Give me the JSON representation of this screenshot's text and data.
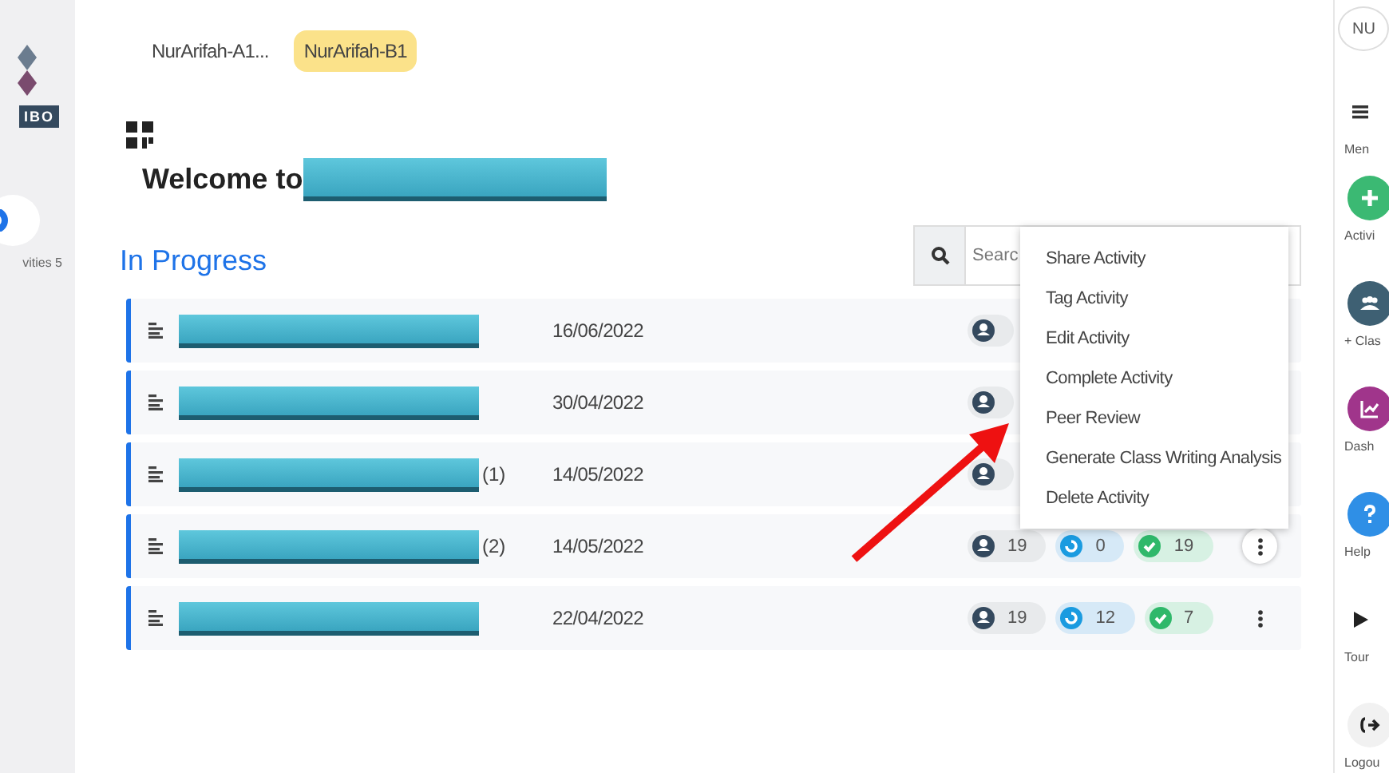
{
  "left_sidebar": {
    "logo_badge": "IBO",
    "label": "vities 5"
  },
  "tabs": [
    {
      "label": "NurArifah-A1...",
      "selected": false
    },
    {
      "label": "NurArifah-B1",
      "selected": true
    }
  ],
  "welcome": {
    "text": "Welcome to"
  },
  "section_title": "In Progress",
  "search": {
    "placeholder": "Searc"
  },
  "rows": [
    {
      "suffix": "",
      "date": "16/06/2022",
      "stats": [
        {
          "kind": "students"
        }
      ]
    },
    {
      "suffix": "",
      "date": "30/04/2022",
      "stats": [
        {
          "kind": "students"
        }
      ]
    },
    {
      "suffix": "(1)",
      "date": "14/05/2022",
      "stats": [
        {
          "kind": "students"
        }
      ]
    },
    {
      "suffix": "(2)",
      "date": "14/05/2022",
      "stats": [
        {
          "kind": "students",
          "count": "19"
        },
        {
          "kind": "progress",
          "count": "0"
        },
        {
          "kind": "done",
          "count": "19"
        }
      ],
      "kebab_active": true
    },
    {
      "suffix": "",
      "date": "22/04/2022",
      "stats": [
        {
          "kind": "students",
          "count": "19"
        },
        {
          "kind": "progress",
          "count": "12"
        },
        {
          "kind": "done",
          "count": "7"
        }
      ],
      "kebab_active": false
    }
  ],
  "context_menu": [
    "Share Activity",
    "Tag Activity",
    "Edit Activity",
    "Complete Activity",
    "Peer Review",
    "Generate Class Writing Analysis",
    "Delete Activity"
  ],
  "right_sidebar": {
    "user": "NU",
    "items": [
      {
        "kind": "menu",
        "label": "Men"
      },
      {
        "kind": "add",
        "label": "Activi"
      },
      {
        "kind": "class",
        "label": "+ Clas"
      },
      {
        "kind": "dashboard",
        "label": "Dash"
      },
      {
        "kind": "help",
        "label": "Help"
      },
      {
        "kind": "tour",
        "label": "Tour"
      },
      {
        "kind": "logout",
        "label": "Logou"
      }
    ]
  }
}
